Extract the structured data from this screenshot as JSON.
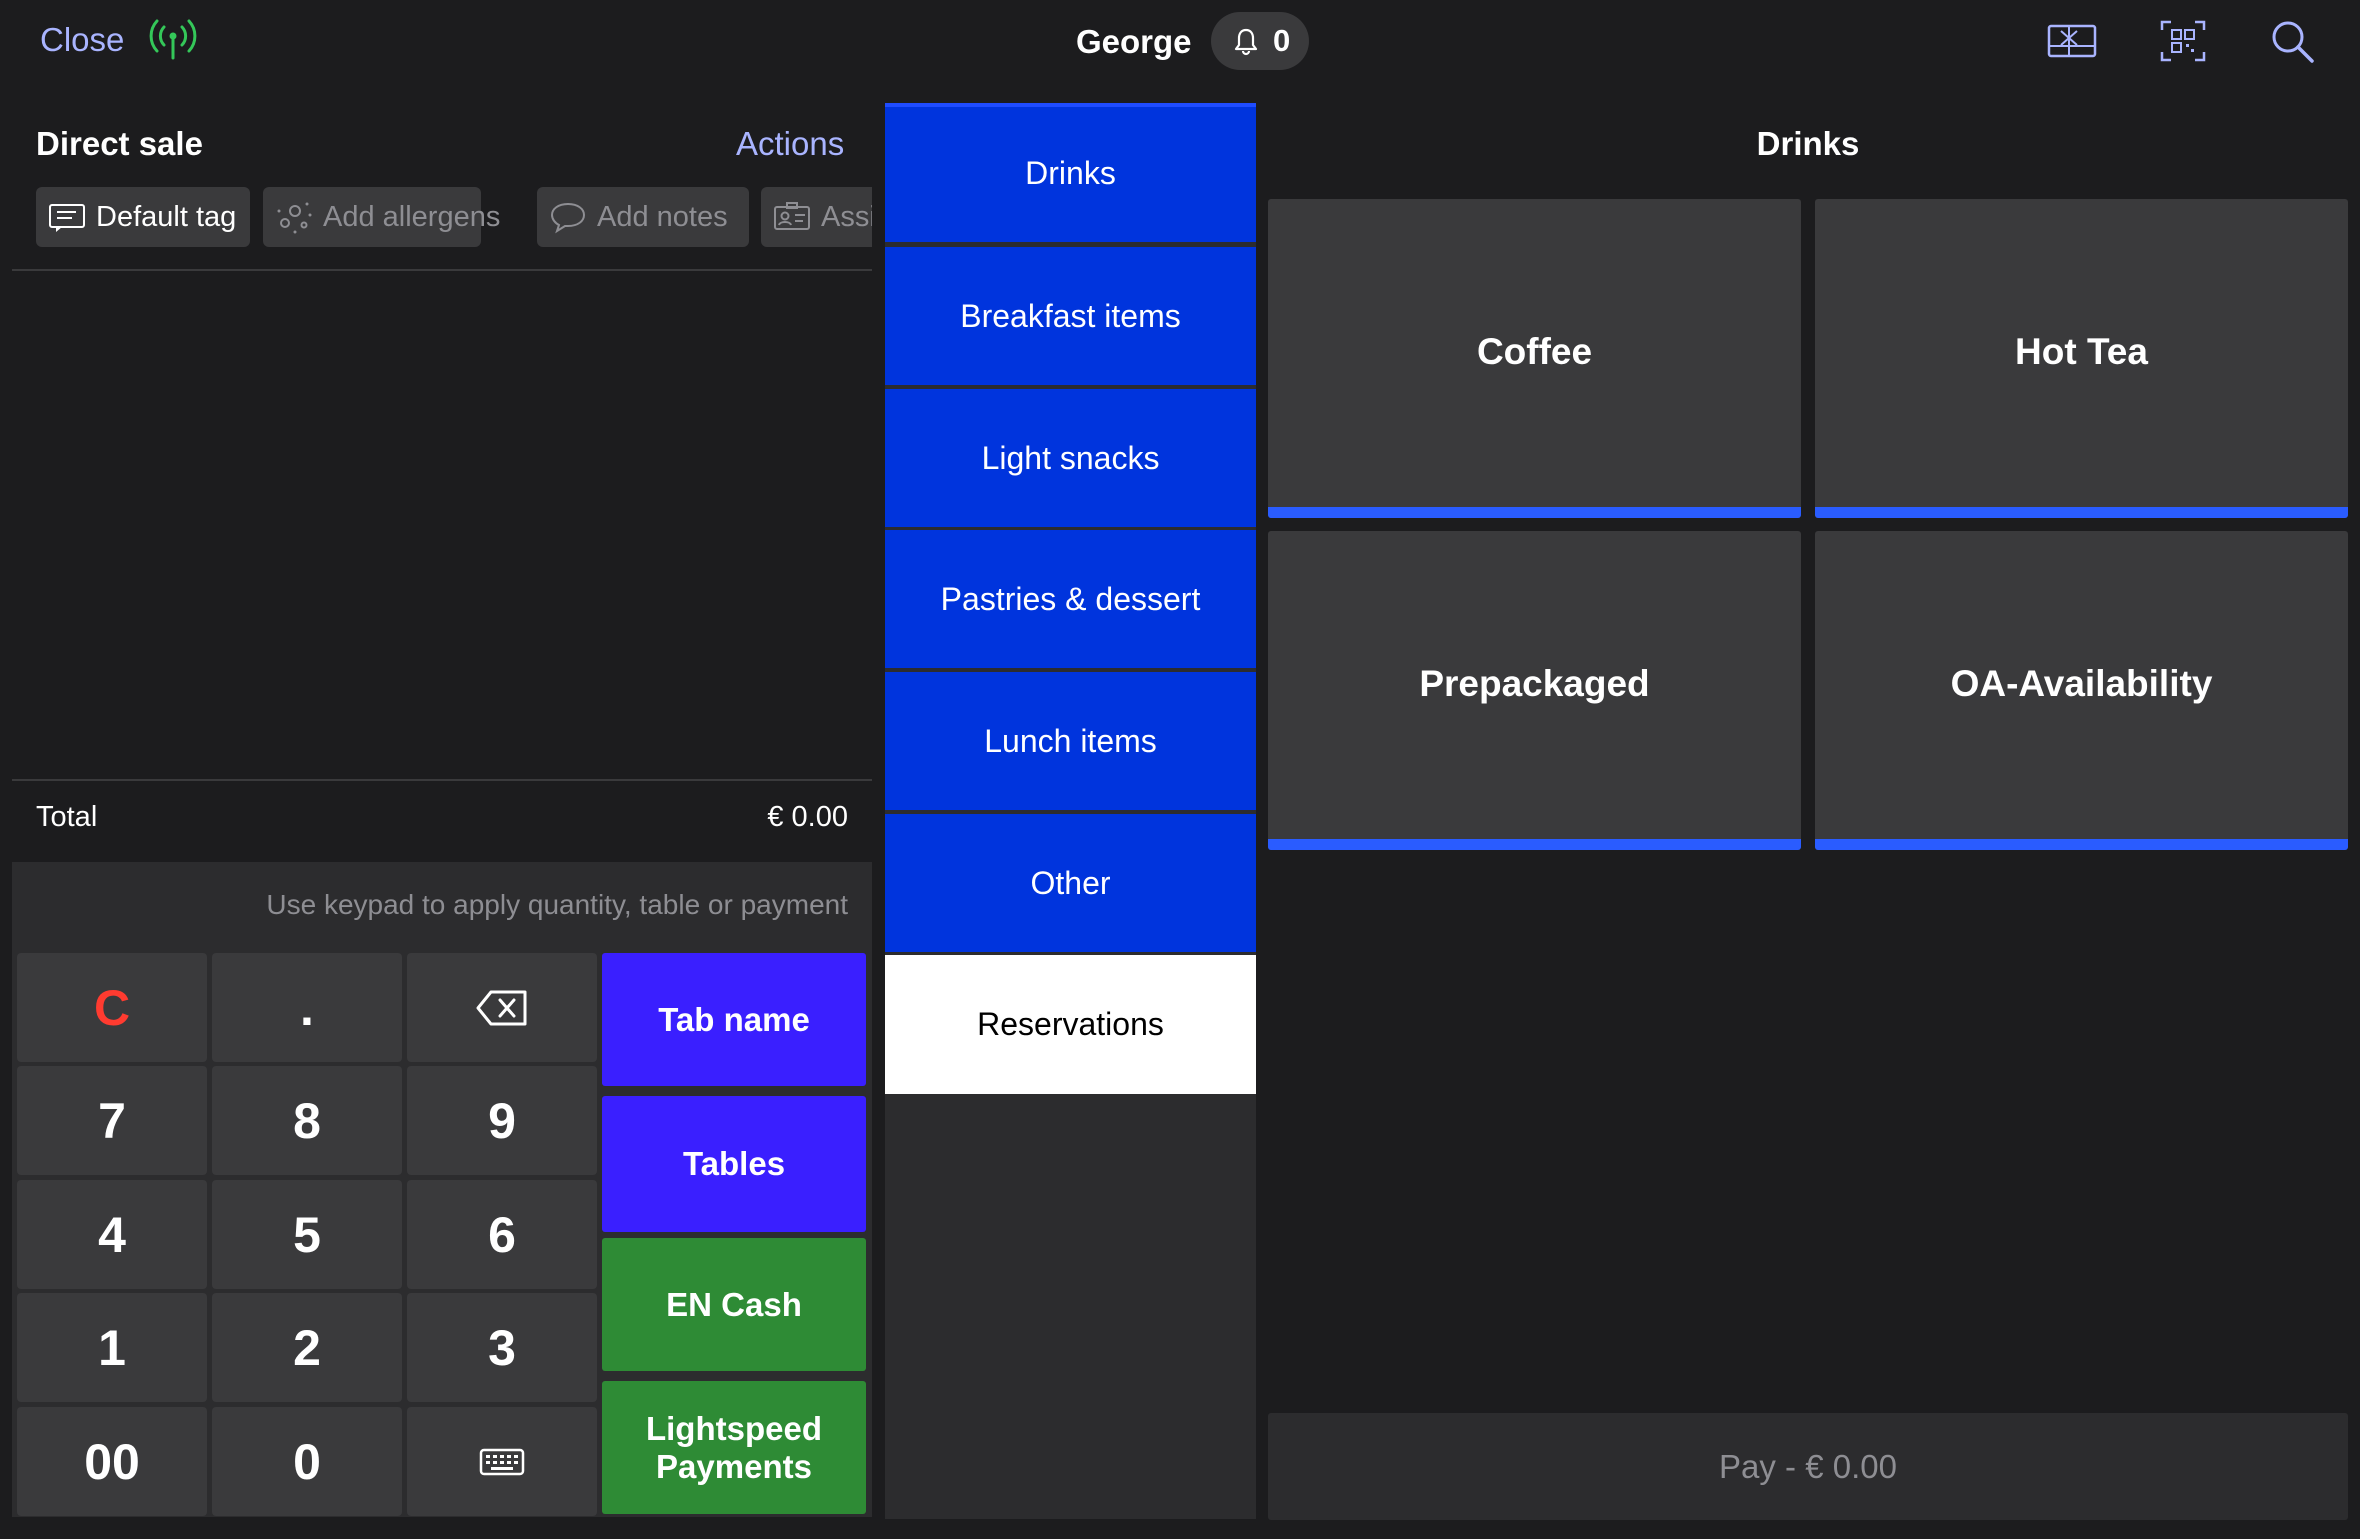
{
  "topbar": {
    "close_label": "Close",
    "user_name": "George",
    "notification_count": "0",
    "icons": [
      "signal-icon",
      "bell-icon",
      "gift-card-icon",
      "qr-scan-icon",
      "search-icon"
    ],
    "accent_color": "#a9b4ff",
    "signal_color": "#34c759"
  },
  "order": {
    "title": "Direct sale",
    "actions_label": "Actions",
    "chips": [
      {
        "label": "Default tag",
        "icon": "tag-icon"
      },
      {
        "label": "Add allergens",
        "icon": "allergens-icon"
      },
      {
        "label": "Add notes",
        "icon": "notes-icon"
      },
      {
        "label": "Assi",
        "icon": "id-card-icon"
      }
    ],
    "total_label": "Total",
    "total_value": "€ 0.00"
  },
  "keypad": {
    "hint": "Use keypad to apply quantity, table or payment",
    "keys": [
      "C",
      ".",
      "backspace-icon",
      "7",
      "8",
      "9",
      "4",
      "5",
      "6",
      "1",
      "2",
      "3",
      "00",
      "0",
      "keyboard-icon"
    ],
    "actions": [
      {
        "label": "Tab name",
        "color": "#3a1fff"
      },
      {
        "label": "Tables",
        "color": "#3a1fff"
      },
      {
        "label": "EN Cash",
        "color": "#2e8b35"
      },
      {
        "label": "Lightspeed Payments",
        "color": "#2e8b35"
      }
    ],
    "clear_color": "#ff3b30"
  },
  "categories": {
    "items": [
      "Drinks",
      "Breakfast items",
      "Light snacks",
      "Pastries & dessert",
      "Lunch items",
      "Other",
      "Reservations"
    ],
    "selected": "Reservations",
    "color": "#0034dd"
  },
  "products": {
    "title": "Drinks",
    "items": [
      "Coffee",
      "Hot Tea",
      "Prepackaged",
      "OA-Availability"
    ],
    "bar_color": "#2a5cff"
  },
  "pay": {
    "label": "Pay - € 0.00"
  }
}
